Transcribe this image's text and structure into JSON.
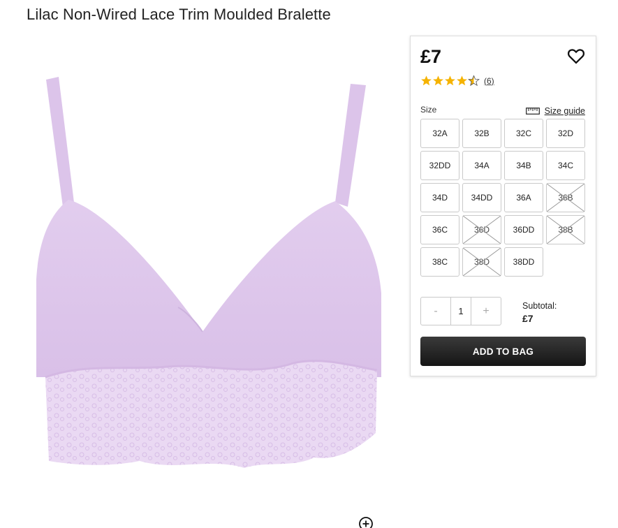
{
  "product": {
    "title": "Lilac Non-Wired Lace Trim Moulded Bralette",
    "price": "£7",
    "rating": 4.5,
    "review_count": "(6)"
  },
  "size_section": {
    "label": "Size",
    "guide_label": "Size guide",
    "sizes": [
      {
        "label": "32A",
        "available": true
      },
      {
        "label": "32B",
        "available": true
      },
      {
        "label": "32C",
        "available": true
      },
      {
        "label": "32D",
        "available": true
      },
      {
        "label": "32DD",
        "available": true
      },
      {
        "label": "34A",
        "available": true
      },
      {
        "label": "34B",
        "available": true
      },
      {
        "label": "34C",
        "available": true
      },
      {
        "label": "34D",
        "available": true
      },
      {
        "label": "34DD",
        "available": true
      },
      {
        "label": "36A",
        "available": true
      },
      {
        "label": "36B",
        "available": false
      },
      {
        "label": "36C",
        "available": true
      },
      {
        "label": "36D",
        "available": false
      },
      {
        "label": "36DD",
        "available": true
      },
      {
        "label": "38B",
        "available": false
      },
      {
        "label": "38C",
        "available": true
      },
      {
        "label": "38D",
        "available": false
      },
      {
        "label": "38DD",
        "available": true
      }
    ]
  },
  "quantity": {
    "minus": "-",
    "value": "1",
    "plus": "+"
  },
  "subtotal": {
    "label": "Subtotal:",
    "value": "£7"
  },
  "add_to_bag": "ADD TO BAG",
  "colors": {
    "lilac": "#e6d2ef",
    "star": "#f5b301",
    "button": "#1f1f1f"
  },
  "icons": {
    "wishlist": "heart-outline-icon",
    "size_guide": "ruler-icon",
    "zoom": "zoom-in-icon"
  }
}
